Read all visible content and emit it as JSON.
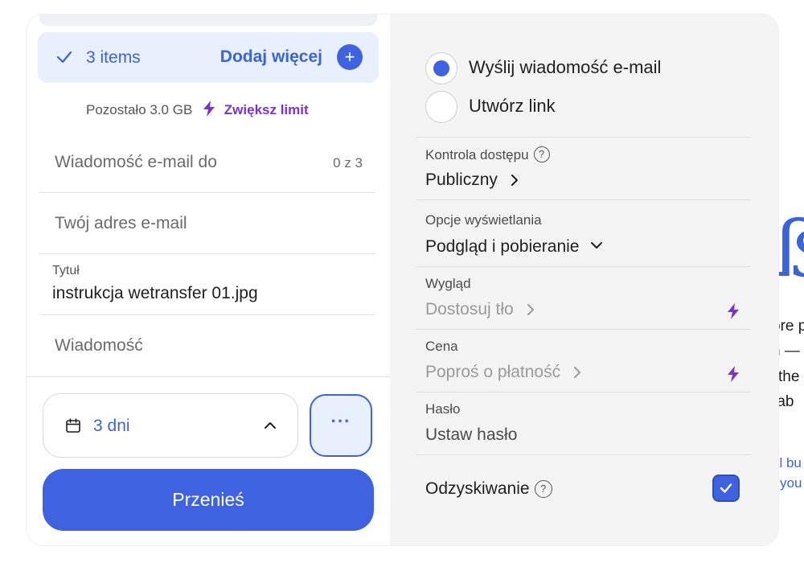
{
  "background": {
    "fragments": [
      "ore p",
      "n —",
      "the",
      "rab",
      "al bu",
      "you"
    ]
  },
  "upload": {
    "items_label": "3 items",
    "add_more_label": "Dodaj więcej",
    "add_icon": "plus-icon",
    "quota_text": "Pozostało 3.0 GB",
    "increase_limit_label": "Zwiększ limit"
  },
  "form": {
    "email_to_placeholder": "Wiadomość e-mail do",
    "email_to_counter": "0 z 3",
    "your_email_placeholder": "Twój adres e-mail",
    "title_label": "Tytuł",
    "title_value": "instrukcja wetransfer 01.jpg",
    "message_placeholder": "Wiadomość"
  },
  "footer": {
    "expiry_value": "3 dni",
    "more_label": "···",
    "transfer_label": "Przenieś"
  },
  "options": {
    "radio_email": "Wyślij wiadomość e-mail",
    "radio_link": "Utwórz link",
    "selected_radio": "email",
    "access_label": "Kontrola dostępu",
    "access_value": "Publiczny",
    "display_label": "Opcje wyświetlania",
    "display_value": "Podgląd i pobieranie",
    "appearance_label": "Wygląd",
    "appearance_value": "Dostosuj tło",
    "price_label": "Cena",
    "price_value": "Poproś o płatność",
    "password_label": "Hasło",
    "password_value": "Ustaw hasło",
    "recovery_label": "Odzyskiwanie",
    "recovery_checked": true
  },
  "colors": {
    "accent": "#3f63e0",
    "accent_light": "#e8effd",
    "premium": "#7a33c8"
  }
}
